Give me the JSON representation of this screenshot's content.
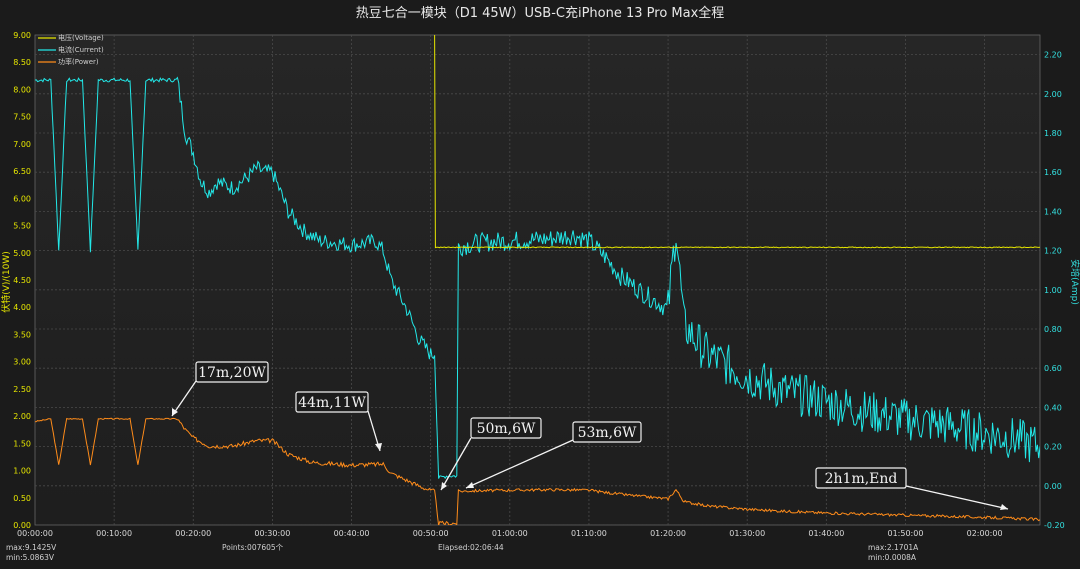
{
  "chart_data": {
    "type": "line",
    "title": "热豆七合一模块（D1 45W）USB-C充iPhone 13 Pro Max全程",
    "ylabel_left": "伏特(V)/(10W)",
    "ylabel_right": "安培(Amp)",
    "grid": true,
    "legend_position": "top-left",
    "x_ticks": [
      "00:00:00",
      "00:10:00",
      "00:20:00",
      "00:30:00",
      "00:40:00",
      "00:50:00",
      "01:00:00",
      "01:10:00",
      "01:20:00",
      "01:30:00",
      "01:40:00",
      "01:50:00",
      "02:00:00"
    ],
    "x_range_minutes": [
      0,
      127
    ],
    "y_left_ticks": [
      "0.00",
      "0.50",
      "1.00",
      "1.50",
      "2.00",
      "2.50",
      "3.00",
      "3.50",
      "4.00",
      "4.50",
      "5.00",
      "5.50",
      "6.00",
      "6.50",
      "7.00",
      "7.50",
      "8.00",
      "8.50",
      "9.00"
    ],
    "y_left_range": [
      0,
      9.0
    ],
    "y_right_ticks": [
      "-0.20",
      "0.00",
      "0.20",
      "0.40",
      "0.60",
      "0.80",
      "1.00",
      "1.20",
      "1.40",
      "1.60",
      "1.80",
      "2.00",
      "2.20"
    ],
    "y_right_range": [
      -0.2,
      2.3
    ],
    "series": [
      {
        "name": "电压(Voltage)",
        "axis": "left",
        "color": "#e6e600",
        "points": [
          [
            0,
            9.1
          ],
          [
            15,
            9.09
          ],
          [
            30,
            9.08
          ],
          [
            45,
            9.07
          ],
          [
            50.5,
            9.06
          ],
          [
            50.6,
            5.1
          ],
          [
            70,
            5.1
          ],
          [
            90,
            5.1
          ],
          [
            110,
            5.1
          ],
          [
            127,
            5.1
          ]
        ]
      },
      {
        "name": "电流(Current)",
        "axis": "right",
        "color": "#22e8e8",
        "points": [
          [
            0,
            2.07
          ],
          [
            2,
            2.07
          ],
          [
            3,
            1.2
          ],
          [
            4,
            2.07
          ],
          [
            6,
            2.07
          ],
          [
            7,
            1.2
          ],
          [
            8,
            2.07
          ],
          [
            12,
            2.07
          ],
          [
            13,
            1.2
          ],
          [
            14,
            2.07
          ],
          [
            17,
            2.07
          ],
          [
            18,
            2.07
          ],
          [
            19,
            1.8
          ],
          [
            20,
            1.7
          ],
          [
            21,
            1.55
          ],
          [
            22,
            1.5
          ],
          [
            23,
            1.55
          ],
          [
            25,
            1.52
          ],
          [
            27,
            1.58
          ],
          [
            28,
            1.62
          ],
          [
            29,
            1.6
          ],
          [
            30,
            1.6
          ],
          [
            32,
            1.4
          ],
          [
            34,
            1.3
          ],
          [
            36,
            1.25
          ],
          [
            38,
            1.24
          ],
          [
            40,
            1.23
          ],
          [
            42,
            1.24
          ],
          [
            43,
            1.25
          ],
          [
            44,
            1.2
          ],
          [
            45,
            1.05
          ],
          [
            47,
            0.9
          ],
          [
            48.5,
            0.75
          ],
          [
            50,
            0.67
          ],
          [
            50.5,
            0.67
          ],
          [
            51,
            0.04
          ],
          [
            52,
            0.05
          ],
          [
            53.3,
            0.05
          ],
          [
            53.5,
            1.22
          ],
          [
            56,
            1.24
          ],
          [
            60,
            1.25
          ],
          [
            65,
            1.26
          ],
          [
            68,
            1.28
          ],
          [
            70,
            1.25
          ],
          [
            72,
            1.17
          ],
          [
            74,
            1.07
          ],
          [
            77,
            0.98
          ],
          [
            80,
            0.9
          ],
          [
            81,
            1.32
          ],
          [
            82,
            0.82
          ],
          [
            85,
            0.67
          ],
          [
            90,
            0.56
          ],
          [
            95,
            0.48
          ],
          [
            100,
            0.43
          ],
          [
            105,
            0.38
          ],
          [
            110,
            0.34
          ],
          [
            115,
            0.31
          ],
          [
            120,
            0.27
          ],
          [
            124,
            0.24
          ],
          [
            127,
            0.2
          ]
        ]
      },
      {
        "name": "功率(Power)",
        "axis": "left",
        "color": "#ff8c1a",
        "points": [
          [
            0,
            1.9
          ],
          [
            2,
            1.95
          ],
          [
            3,
            1.1
          ],
          [
            4,
            1.95
          ],
          [
            6,
            1.95
          ],
          [
            7,
            1.1
          ],
          [
            8,
            1.95
          ],
          [
            12,
            1.95
          ],
          [
            13,
            1.1
          ],
          [
            14,
            1.95
          ],
          [
            17,
            1.95
          ],
          [
            18,
            1.95
          ],
          [
            19,
            1.75
          ],
          [
            20,
            1.6
          ],
          [
            22,
            1.45
          ],
          [
            25,
            1.45
          ],
          [
            28,
            1.55
          ],
          [
            30,
            1.55
          ],
          [
            32,
            1.3
          ],
          [
            35,
            1.15
          ],
          [
            40,
            1.1
          ],
          [
            44,
            1.12
          ],
          [
            45,
            0.95
          ],
          [
            47,
            0.82
          ],
          [
            48.5,
            0.72
          ],
          [
            50,
            0.63
          ],
          [
            50.5,
            0.62
          ],
          [
            51,
            0.03
          ],
          [
            53.3,
            0.03
          ],
          [
            53.5,
            0.62
          ],
          [
            56,
            0.63
          ],
          [
            60,
            0.64
          ],
          [
            65,
            0.65
          ],
          [
            70,
            0.64
          ],
          [
            72,
            0.6
          ],
          [
            75,
            0.55
          ],
          [
            80,
            0.48
          ],
          [
            81,
            0.65
          ],
          [
            82,
            0.43
          ],
          [
            85,
            0.35
          ],
          [
            90,
            0.29
          ],
          [
            95,
            0.25
          ],
          [
            100,
            0.22
          ],
          [
            105,
            0.2
          ],
          [
            110,
            0.18
          ],
          [
            115,
            0.16
          ],
          [
            120,
            0.14
          ],
          [
            124,
            0.12
          ],
          [
            127,
            0.1
          ]
        ]
      }
    ],
    "annotations": [
      {
        "text": "17m,20W",
        "time": "00:17:00",
        "value_left": 2.0
      },
      {
        "text": "44m,11W",
        "time": "00:44:00",
        "value_left": 1.1
      },
      {
        "text": "50m,6W",
        "time": "00:50:00",
        "value_left": 0.6
      },
      {
        "text": "53m,6W",
        "time": "00:53:00",
        "value_left": 0.63
      },
      {
        "text": "2h1m,End",
        "time": "02:01:00",
        "value_left": 0.15
      }
    ]
  },
  "footer": {
    "voltage_max": "max:9.1425V",
    "voltage_min": "min:5.0863V",
    "points": "Points:007605个",
    "elapsed": "Elapsed:02:06:44",
    "current_max": "max:2.1701A",
    "current_min": "min:0.0008A"
  }
}
